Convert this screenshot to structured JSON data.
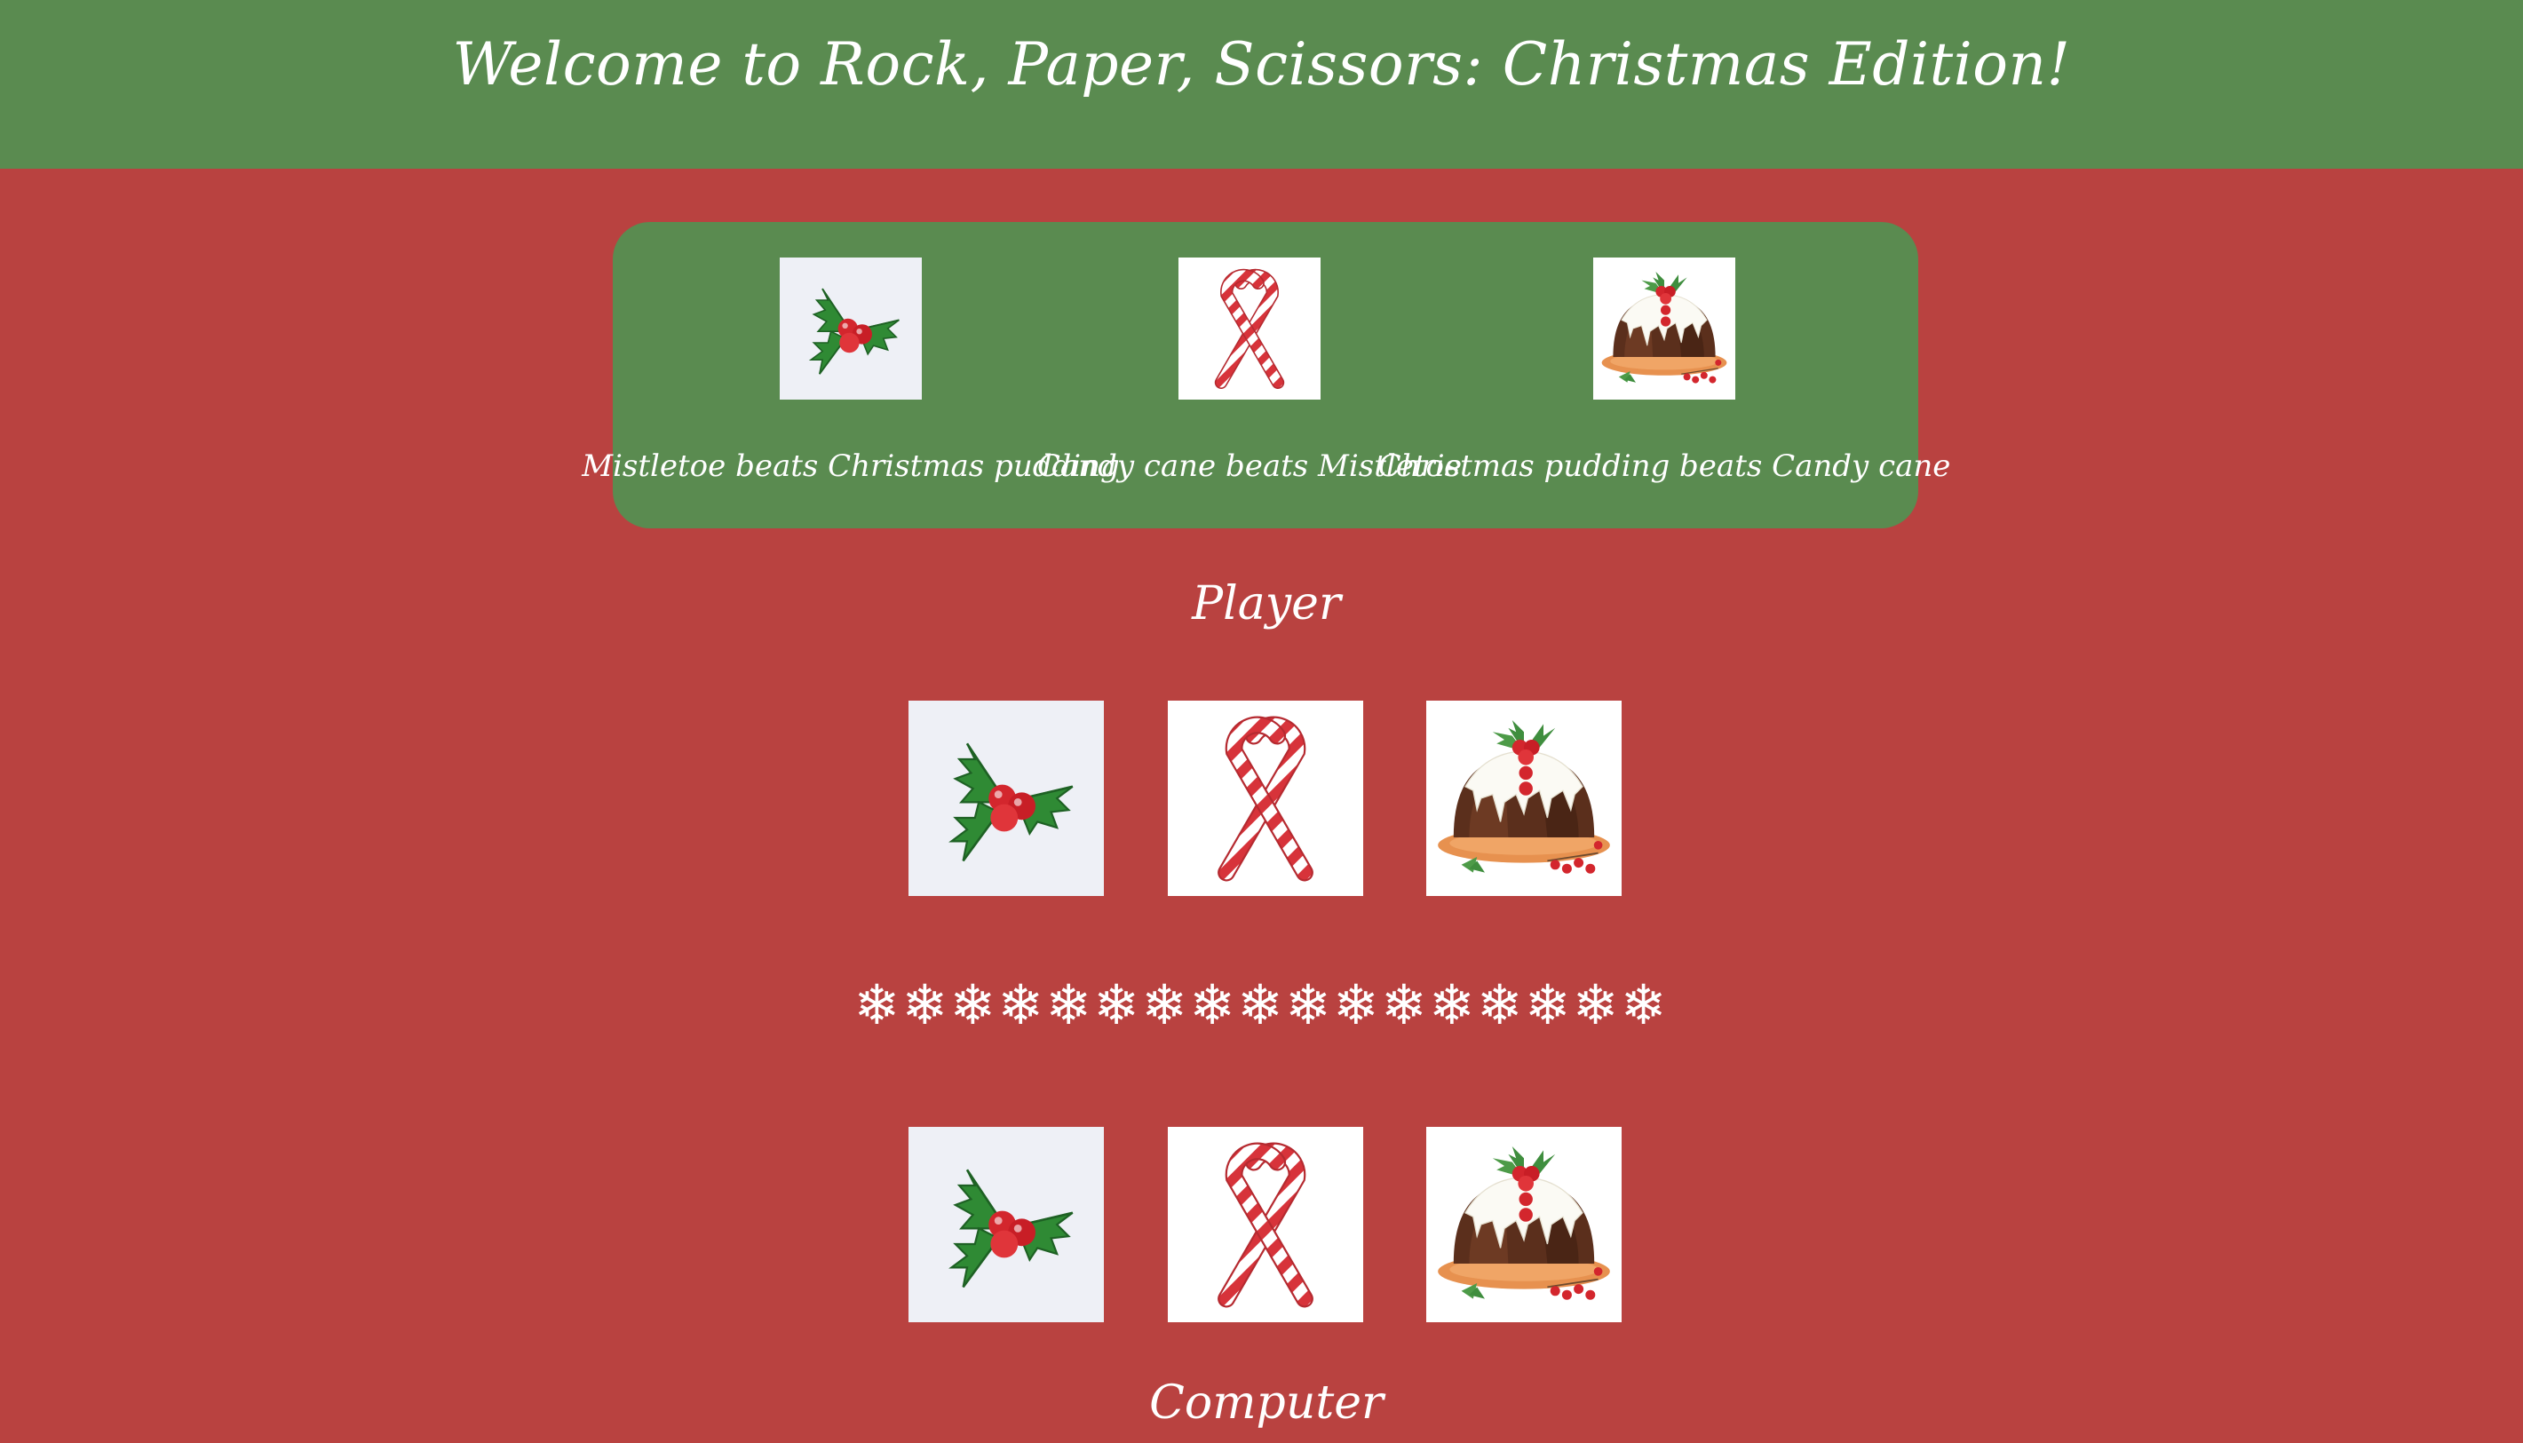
{
  "header": {
    "title": "Welcome to Rock, Paper, Scissors: Christmas Edition!"
  },
  "rules": [
    {
      "icon": "mistletoe-icon",
      "text": "Mistletoe beats Christmas pudding"
    },
    {
      "icon": "candy-cane-icon",
      "text": "Candy cane beats Mistletoe"
    },
    {
      "icon": "christmas-pudding-icon",
      "text": "Christmas pudding beats Candy cane"
    }
  ],
  "player": {
    "label": "Player",
    "choices": [
      "mistletoe-icon",
      "candy-cane-icon",
      "christmas-pudding-icon"
    ]
  },
  "divider": "❄❄❄❄❄❄❄❄❄❄❄❄❄❄❄❄❄",
  "computer": {
    "label": "Computer",
    "choices": [
      "mistletoe-icon",
      "candy-cane-icon",
      "christmas-pudding-icon"
    ]
  },
  "colors": {
    "background": "#b94240",
    "panel_green": "#5a8b50",
    "text": "#ffffff"
  }
}
